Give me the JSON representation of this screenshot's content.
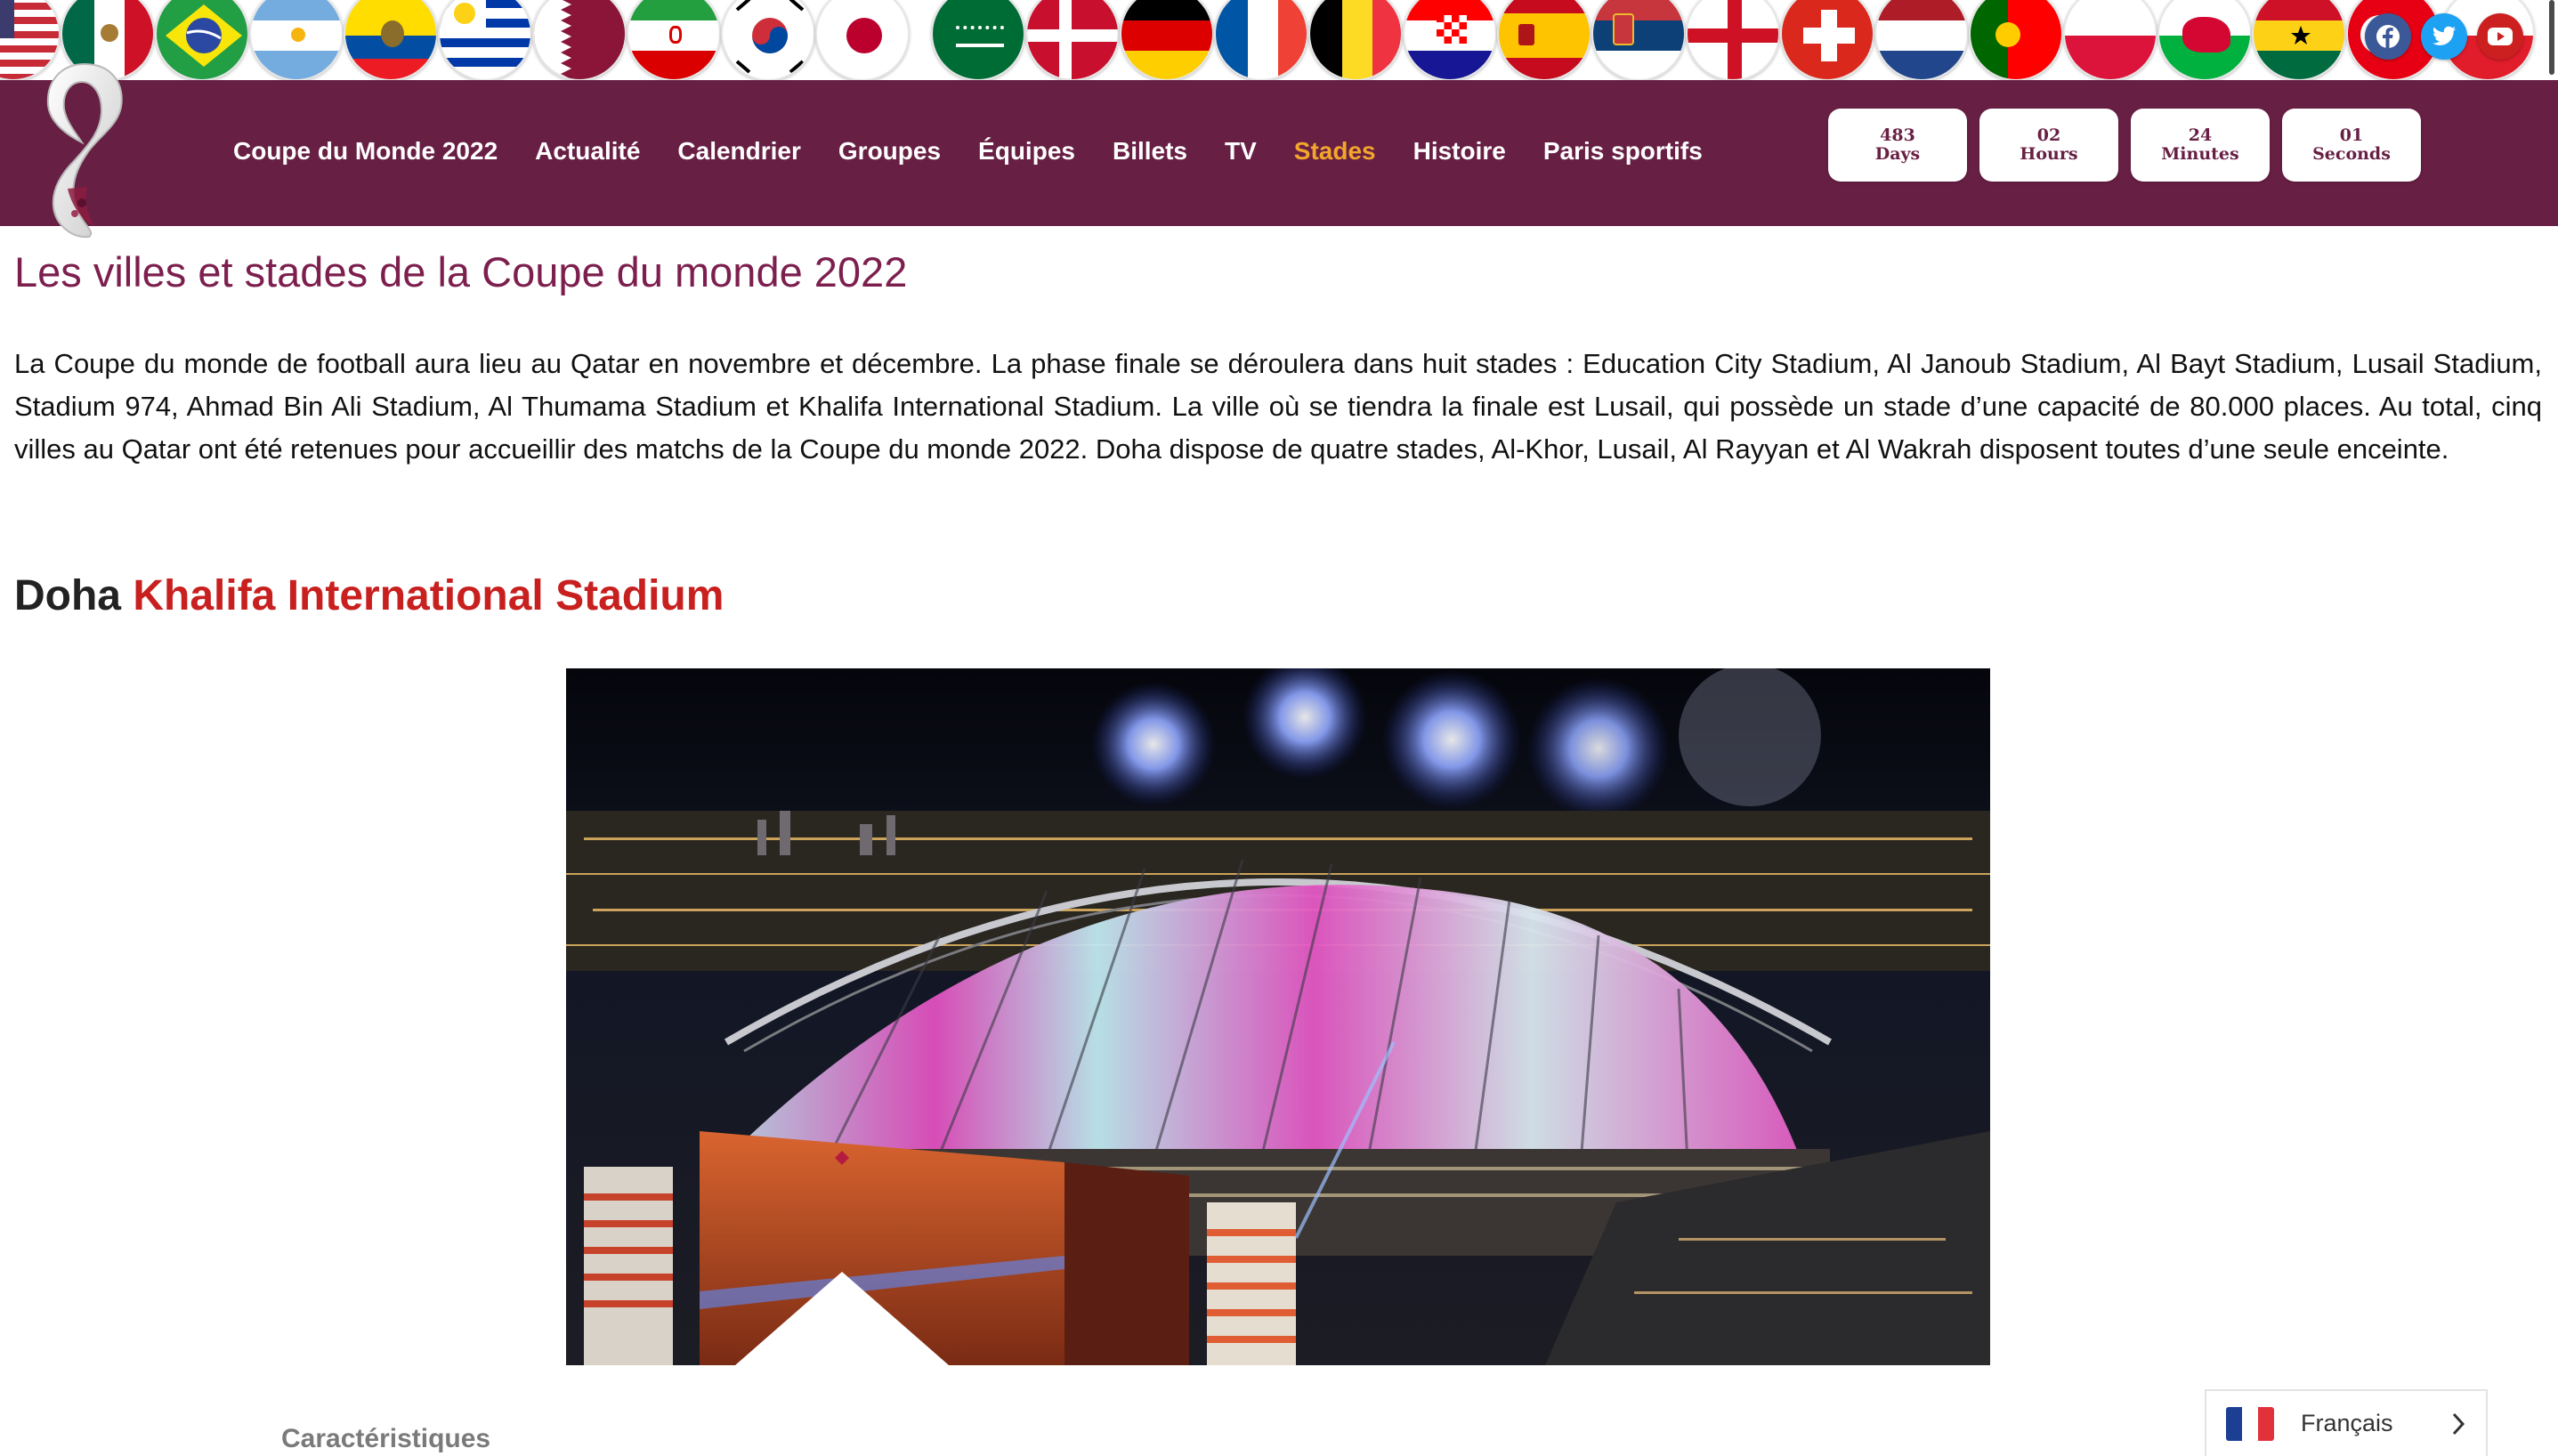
{
  "nav": {
    "items": [
      {
        "label": "Coupe du Monde 2022",
        "active": false
      },
      {
        "label": "Actualité",
        "active": false
      },
      {
        "label": "Calendrier",
        "active": false
      },
      {
        "label": "Groupes",
        "active": false
      },
      {
        "label": "Équipes",
        "active": false
      },
      {
        "label": "Billets",
        "active": false
      },
      {
        "label": "TV",
        "active": false
      },
      {
        "label": "Stades",
        "active": true
      },
      {
        "label": "Histoire",
        "active": false
      },
      {
        "label": "Paris sportifs",
        "active": false
      }
    ],
    "active_color": "#f2a62c"
  },
  "countdown": [
    {
      "value": "483",
      "unit": "Days"
    },
    {
      "value": "02",
      "unit": "Hours"
    },
    {
      "value": "24",
      "unit": "Minutes"
    },
    {
      "value": "01",
      "unit": "Seconds"
    }
  ],
  "flags": [
    "usa",
    "mexico",
    "brazil",
    "argentina",
    "ecuador",
    "uruguay",
    "qatar",
    "iran",
    "south-korea",
    "japan",
    "saudi-arabia",
    "denmark",
    "germany",
    "france",
    "belgium",
    "croatia",
    "spain",
    "serbia",
    "england",
    "switzerland",
    "netherlands",
    "portugal",
    "poland",
    "wales",
    "ghana",
    "tunisia"
  ],
  "social": [
    {
      "name": "facebook-icon",
      "color": "#3b5998"
    },
    {
      "name": "twitter-icon",
      "color": "#1da1f2"
    },
    {
      "name": "youtube-icon",
      "color": "#cc1f1f"
    }
  ],
  "page": {
    "title": "Les villes et stades de la Coupe du monde 2022",
    "intro": "La Coupe du monde de football aura lieu au Qatar en novembre et décembre. La phase finale se déroulera dans huit stades : Education City Stadium, Al Janoub Stadium, Al Bayt Stadium, Lusail Stadium, Stadium 974, Ahmad Bin Ali Stadium, Al Thumama Stadium et Khalifa International Stadium. La ville où se tiendra la finale est Lusail, qui possède un stade d’une capacité de 80.000 places. Au total, cinq villes au Qatar ont été retenues pour accueillir des matchs de la Coupe du monde 2022. Doha dispose de quatre stades, Al-Khor, Lusail, Al Rayyan et Al Wakrah disposent toutes d’une seule enceinte."
  },
  "section": {
    "city": "Doha",
    "stadium": "Khalifa International Stadium"
  },
  "tab": {
    "label": "Caractéristiques"
  },
  "language": {
    "label": "Français"
  },
  "colors": {
    "brand": "#681f44",
    "title": "#7d1f4e",
    "stadium": "#c8201f"
  }
}
